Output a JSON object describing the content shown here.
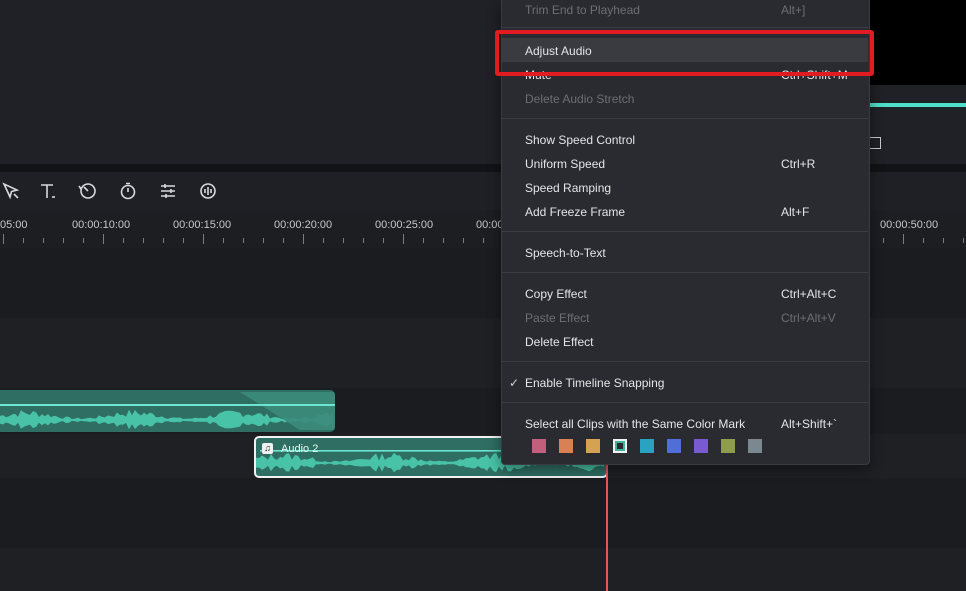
{
  "menu": {
    "trim_end": {
      "label": "Trim End to Playhead",
      "shortcut": "Alt+]"
    },
    "adjust_audio": {
      "label": "Adjust Audio"
    },
    "mute": {
      "label": "Mute",
      "shortcut": "Ctrl+Shift+M"
    },
    "delete_audio_stretch": {
      "label": "Delete Audio Stretch"
    },
    "show_speed_control": {
      "label": "Show Speed Control"
    },
    "uniform_speed": {
      "label": "Uniform Speed",
      "shortcut": "Ctrl+R"
    },
    "speed_ramping": {
      "label": "Speed Ramping"
    },
    "add_freeze_frame": {
      "label": "Add Freeze Frame",
      "shortcut": "Alt+F"
    },
    "speech_to_text": {
      "label": "Speech-to-Text"
    },
    "copy_effect": {
      "label": "Copy Effect",
      "shortcut": "Ctrl+Alt+C"
    },
    "paste_effect": {
      "label": "Paste Effect",
      "shortcut": "Ctrl+Alt+V"
    },
    "delete_effect": {
      "label": "Delete Effect"
    },
    "enable_snapping": {
      "label": "Enable Timeline Snapping",
      "checked": true
    },
    "select_same_color": {
      "label": "Select all Clips with the Same Color Mark",
      "shortcut": "Alt+Shift+`"
    },
    "color_marks": [
      "#c25f7d",
      "#d98155",
      "#d4a253",
      "#3fb39c",
      "#2aa2c2",
      "#4f6ed8",
      "#7a5ad0",
      "#8d9d4c",
      "#7b8890"
    ],
    "selected_color_index": 3
  },
  "ruler": {
    "labels": [
      "05:00",
      "00:00:10:00",
      "00:00:15:00",
      "00:00:20:00",
      "00:00:25:00",
      "00:00",
      "00:00:50:00"
    ]
  },
  "timeline": {
    "clip2_label": "Audio 2",
    "clip_color": "#2f6e62",
    "wave_color": "#48c3a7",
    "playhead_color": "#e8545b"
  },
  "toolbar": {
    "icons": [
      "select-tool-icon",
      "text-tool-icon",
      "speed-icon",
      "timer-icon",
      "adjust-icon",
      "audio-icon"
    ]
  },
  "accent": "#e21b23"
}
